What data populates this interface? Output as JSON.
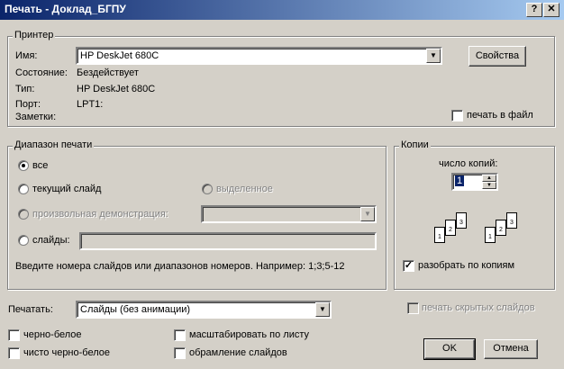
{
  "window": {
    "title": "Печать - Доклад_БГПУ",
    "help_glyph": "?",
    "close_glyph": "✕"
  },
  "printer": {
    "group_label": "Принтер",
    "name_label": "Имя:",
    "name_value": "HP DeskJet 680C",
    "properties_button": "Свойства",
    "status_label": "Состояние:",
    "status_value": "Бездействует",
    "type_label": "Тип:",
    "type_value": "HP DeskJet 680C",
    "port_label": "Порт:",
    "port_value": "LPT1:",
    "notes_label": "Заметки:",
    "print_to_file": "печать в файл"
  },
  "range": {
    "group_label": "Диапазон печати",
    "all": "все",
    "current_slide": "текущий слайд",
    "selection": "выделенное",
    "custom_show": "произвольная демонстрация:",
    "slides": "слайды:",
    "hint": "Введите номера слайдов или диапазонов номеров. Например: 1;3;5-12"
  },
  "copies": {
    "group_label": "Копии",
    "count_label": "число копий:",
    "count_value": "1",
    "collate": "разобрать по копиям",
    "page_numbers": [
      "1",
      "2",
      "3"
    ]
  },
  "print_what": {
    "label": "Печатать:",
    "value": "Слайды (без анимации)",
    "hidden_slides": "печать скрытых слайдов"
  },
  "options": {
    "grayscale": "черно-белое",
    "pure_bw": "чисто черно-белое",
    "scale_to_fit": "масштабировать по листу",
    "frame_slides": "обрамление слайдов"
  },
  "buttons": {
    "ok": "OK",
    "cancel": "Отмена"
  },
  "icons": {
    "dropdown_arrow": "▼",
    "spin_up": "▲",
    "spin_down": "▼",
    "check": "✓"
  }
}
